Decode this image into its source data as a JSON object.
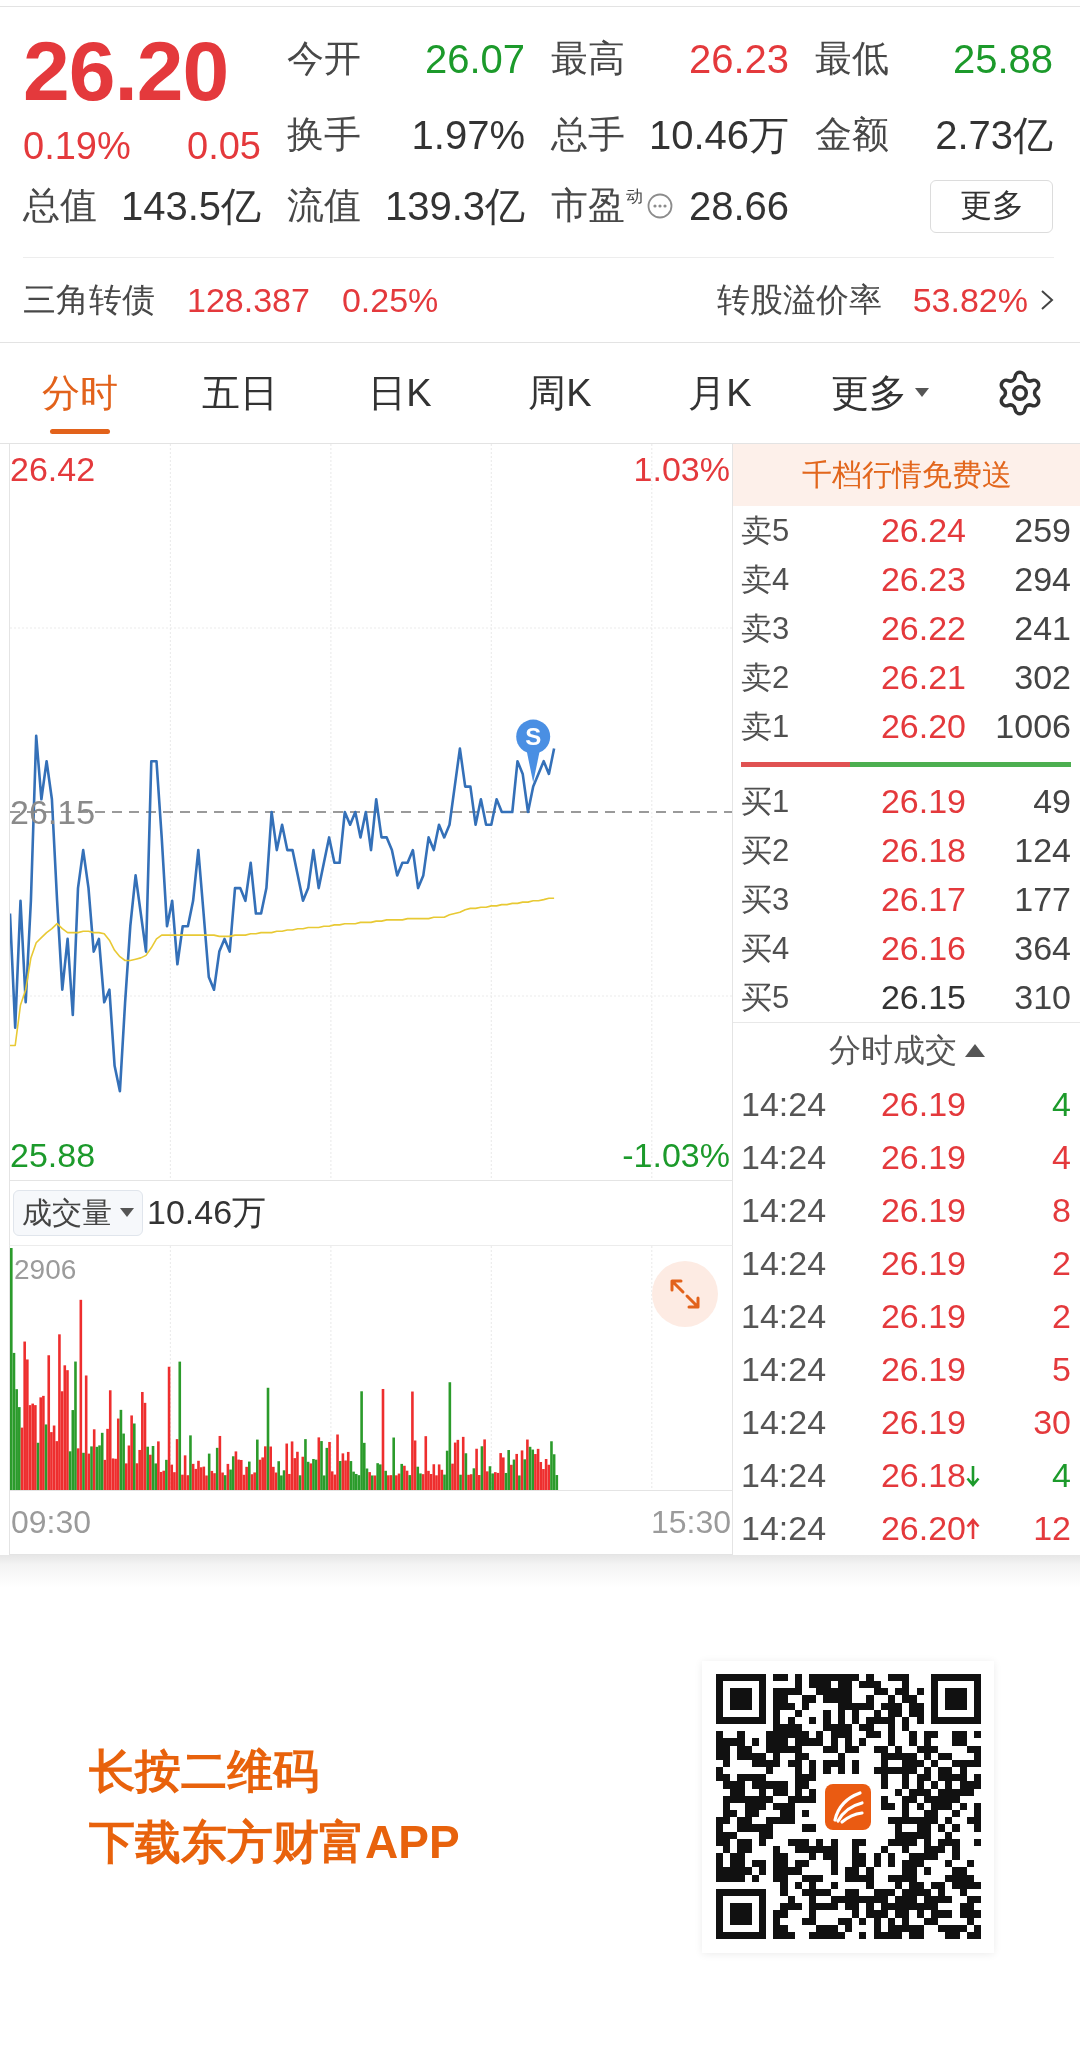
{
  "quote": {
    "price": "26.20",
    "change_pct": "0.19%",
    "change": "0.05",
    "rising": true
  },
  "stats": [
    {
      "label": "今开",
      "value": "26.07",
      "rising": false,
      "falling": true
    },
    {
      "label": "最高",
      "value": "26.23",
      "rising": true,
      "falling": false
    },
    {
      "label": "最低",
      "value": "25.88",
      "rising": false,
      "falling": true
    },
    {
      "label": "换手",
      "value": "1.97%",
      "rising": false,
      "falling": false
    },
    {
      "label": "总手",
      "value": "10.46万",
      "rising": false,
      "falling": false
    },
    {
      "label": "金额",
      "value": "2.73亿",
      "rising": false,
      "falling": false
    }
  ],
  "valuation": [
    {
      "label": "总值",
      "value": "143.5亿",
      "kind": "plain"
    },
    {
      "label": "流值",
      "value": "139.3亿",
      "kind": "plain"
    },
    {
      "label": "市盈$^{动}$",
      "value": "28.66",
      "kind": "info"
    }
  ],
  "more_button": "更多",
  "bond": {
    "name": "三角转债",
    "price": "128.387",
    "change_pct": "0.25%",
    "rising": true,
    "premium_label": "转股溢价率",
    "premium_value": "53.82%",
    "premium_rising": true
  },
  "tabs": [
    {
      "label": "分时",
      "selected": true,
      "kind": "period"
    },
    {
      "label": "五日",
      "selected": false,
      "kind": "period"
    },
    {
      "label": "日K",
      "selected": false,
      "kind": "period"
    },
    {
      "label": "周K",
      "selected": false,
      "kind": "period"
    },
    {
      "label": "月K",
      "selected": false,
      "kind": "period"
    },
    {
      "label": "更多",
      "selected": false,
      "kind": "dropdown"
    }
  ],
  "price_chart": {
    "high_pct": "1.03%",
    "low_pct": "-1.03%",
    "marker": "S",
    "chart_data": {
      "type": "line",
      "categories": [
        null,
        null,
        null,
        null,
        null,
        null,
        null,
        null,
        null,
        null,
        null,
        null,
        null,
        null,
        null,
        null,
        null,
        null,
        null,
        null,
        null,
        null,
        null,
        null,
        null,
        null,
        null,
        null,
        null,
        null,
        null,
        null,
        null,
        null,
        null,
        null,
        null,
        null,
        null,
        null,
        null,
        null,
        null,
        null,
        null,
        null,
        null,
        null,
        null,
        null,
        null,
        null,
        null,
        null,
        null,
        null,
        null,
        null,
        null,
        null,
        null,
        null,
        null,
        null,
        null,
        null,
        null,
        null,
        null,
        null,
        null,
        null,
        null,
        null,
        null,
        null,
        null,
        null,
        null,
        null,
        null,
        null,
        null,
        null,
        null,
        null,
        null,
        null,
        null,
        null,
        null,
        null,
        null,
        null,
        null,
        null,
        null,
        null,
        null,
        null,
        null,
        null,
        null,
        null,
        null,
        null,
        null,
        null,
        null,
        null,
        null,
        null,
        null,
        null,
        null,
        null,
        null,
        null,
        null,
        null,
        null,
        null,
        null,
        null,
        null,
        null,
        null,
        null,
        null,
        null,
        null,
        null,
        null,
        null,
        null,
        null,
        null,
        null,
        null
      ],
      "ylim": [
        25.86,
        26.44
      ],
      "yticks": [
        {
          "value": 26.42,
          "label": "26.42"
        },
        {
          "value": 26.15,
          "label": "26.15"
        },
        {
          "value": 25.88,
          "label": "25.88"
        }
      ],
      "ref_lines": [
        {
          "axis": "y",
          "value": 26.15
        }
      ],
      "series": [
        {
          "color": "#3470b8",
          "values": [
            26.07,
            25.98,
            26.08,
            26.0,
            26.08,
            26.21,
            26.16,
            26.19,
            26.16,
            26.08,
            26.01,
            26.05,
            25.99,
            26.09,
            26.12,
            26.09,
            26.04,
            26.05,
            26.0,
            26.01,
            25.95,
            25.93,
            26.0,
            26.06,
            26.1,
            26.07,
            26.04,
            26.19,
            26.19,
            26.13,
            26.06,
            26.08,
            26.03,
            26.06,
            26.06,
            26.08,
            26.12,
            26.07,
            26.02,
            26.01,
            26.04,
            26.05,
            26.04,
            26.09,
            26.09,
            26.08,
            26.11,
            26.07,
            26.07,
            26.09,
            26.15,
            26.12,
            26.14,
            26.12,
            26.12,
            26.1,
            26.08,
            26.09,
            26.12,
            26.09,
            26.11,
            26.13,
            26.11,
            26.11,
            26.15,
            26.14,
            26.15,
            26.13,
            26.15,
            26.12,
            26.16,
            26.13,
            26.13,
            26.12,
            26.1,
            26.11,
            26.11,
            26.12,
            26.09,
            26.1,
            26.13,
            26.12,
            26.14,
            26.13,
            26.14,
            26.17,
            26.2,
            26.17,
            26.17,
            26.14,
            26.16,
            26.14,
            26.14,
            26.16,
            26.15,
            26.15,
            26.15,
            26.19,
            26.18,
            26.15,
            26.17,
            26.18,
            26.19,
            26.18,
            26.2,
            null,
            null,
            null,
            null,
            null,
            null,
            null,
            null,
            null,
            null,
            null,
            null,
            null,
            null,
            null,
            null,
            null,
            null,
            null,
            null,
            null,
            null,
            null,
            null,
            null,
            null,
            null,
            null,
            null,
            null,
            null,
            null,
            null,
            null
          ]
        },
        {
          "color": "#e8c934",
          "values": [
            25.966,
            25.966,
            25.998,
            26.01,
            26.035,
            26.047,
            26.051,
            26.055,
            26.058,
            26.062,
            26.058,
            26.055,
            26.055,
            26.055,
            26.056,
            26.056,
            26.055,
            26.055,
            26.054,
            26.049,
            26.041,
            26.036,
            26.033,
            26.033,
            26.034,
            26.035,
            26.037,
            26.043,
            26.05,
            26.053,
            26.053,
            26.053,
            26.053,
            26.053,
            26.053,
            26.053,
            26.053,
            26.053,
            26.053,
            26.053,
            26.052,
            26.052,
            26.052,
            26.053,
            26.053,
            26.053,
            26.054,
            26.054,
            26.055,
            26.055,
            26.055,
            26.056,
            26.056,
            26.057,
            26.057,
            26.058,
            26.058,
            26.059,
            26.059,
            26.059,
            26.06,
            26.06,
            26.061,
            26.061,
            26.062,
            26.062,
            26.062,
            26.063,
            26.063,
            26.063,
            26.064,
            26.064,
            26.065,
            26.065,
            26.065,
            26.065,
            26.066,
            26.066,
            26.066,
            26.066,
            26.066,
            26.067,
            26.067,
            26.067,
            26.069,
            26.07,
            26.071,
            26.073,
            26.074,
            26.074,
            26.075,
            26.075,
            26.076,
            26.076,
            26.077,
            26.077,
            26.078,
            26.078,
            26.079,
            26.079,
            26.08,
            26.08,
            26.081,
            26.082,
            26.082,
            null,
            null,
            null,
            null,
            null,
            null,
            null,
            null,
            null,
            null,
            null,
            null,
            null,
            null,
            null,
            null,
            null,
            null,
            null,
            null,
            null,
            null,
            null,
            null,
            null,
            null,
            null,
            null,
            null,
            null,
            null,
            null,
            null,
            null
          ]
        }
      ]
    }
  },
  "volume": {
    "selector": "成交量",
    "total": "10.46万",
    "max_label": "2906",
    "time_start": "09:30",
    "time_end": "15:30"
  },
  "order_book": {
    "banner": "千档行情免费送",
    "asks": [
      {
        "label": "卖5",
        "price": "26.24",
        "volume": "259",
        "rising": true
      },
      {
        "label": "卖4",
        "price": "26.23",
        "volume": "294",
        "rising": true
      },
      {
        "label": "卖3",
        "price": "26.22",
        "volume": "241",
        "rising": true
      },
      {
        "label": "卖2",
        "price": "26.21",
        "volume": "302",
        "rising": true
      },
      {
        "label": "卖1",
        "price": "26.20",
        "volume": "1006",
        "rising": true
      }
    ],
    "ratio_bar": {
      "level": 0.33
    },
    "bids": [
      {
        "label": "买1",
        "price": "26.19",
        "volume": "49",
        "rising": true
      },
      {
        "label": "买2",
        "price": "26.18",
        "volume": "124",
        "rising": true
      },
      {
        "label": "买3",
        "price": "26.17",
        "volume": "177",
        "rising": true
      },
      {
        "label": "买4",
        "price": "26.16",
        "volume": "364",
        "rising": true
      },
      {
        "label": "买5",
        "price": "26.15",
        "volume": "310",
        "rising": false
      }
    ]
  },
  "trades": {
    "title": "分时成交",
    "rows": [
      {
        "time": "14:24",
        "price": "26.19",
        "volume": "4",
        "rising": true,
        "buy": false,
        "up_arrow": false,
        "down_arrow": false
      },
      {
        "time": "14:24",
        "price": "26.19",
        "volume": "4",
        "rising": true,
        "buy": true,
        "up_arrow": false,
        "down_arrow": false
      },
      {
        "time": "14:24",
        "price": "26.19",
        "volume": "8",
        "rising": true,
        "buy": true,
        "up_arrow": false,
        "down_arrow": false
      },
      {
        "time": "14:24",
        "price": "26.19",
        "volume": "2",
        "rising": true,
        "buy": true,
        "up_arrow": false,
        "down_arrow": false
      },
      {
        "time": "14:24",
        "price": "26.19",
        "volume": "2",
        "rising": true,
        "buy": true,
        "up_arrow": false,
        "down_arrow": false
      },
      {
        "time": "14:24",
        "price": "26.19",
        "volume": "5",
        "rising": true,
        "buy": true,
        "up_arrow": false,
        "down_arrow": false
      },
      {
        "time": "14:24",
        "price": "26.19",
        "volume": "30",
        "rising": true,
        "buy": true,
        "up_arrow": false,
        "down_arrow": false
      },
      {
        "time": "14:24",
        "price": "26.18",
        "volume": "4",
        "rising": true,
        "buy": false,
        "up_arrow": false,
        "down_arrow": true
      },
      {
        "time": "14:24",
        "price": "26.20",
        "volume": "12",
        "rising": true,
        "buy": true,
        "up_arrow": true,
        "down_arrow": false
      }
    ]
  },
  "promo": {
    "lines": [
      "长按二维码",
      "下载东方财富APP"
    ]
  }
}
